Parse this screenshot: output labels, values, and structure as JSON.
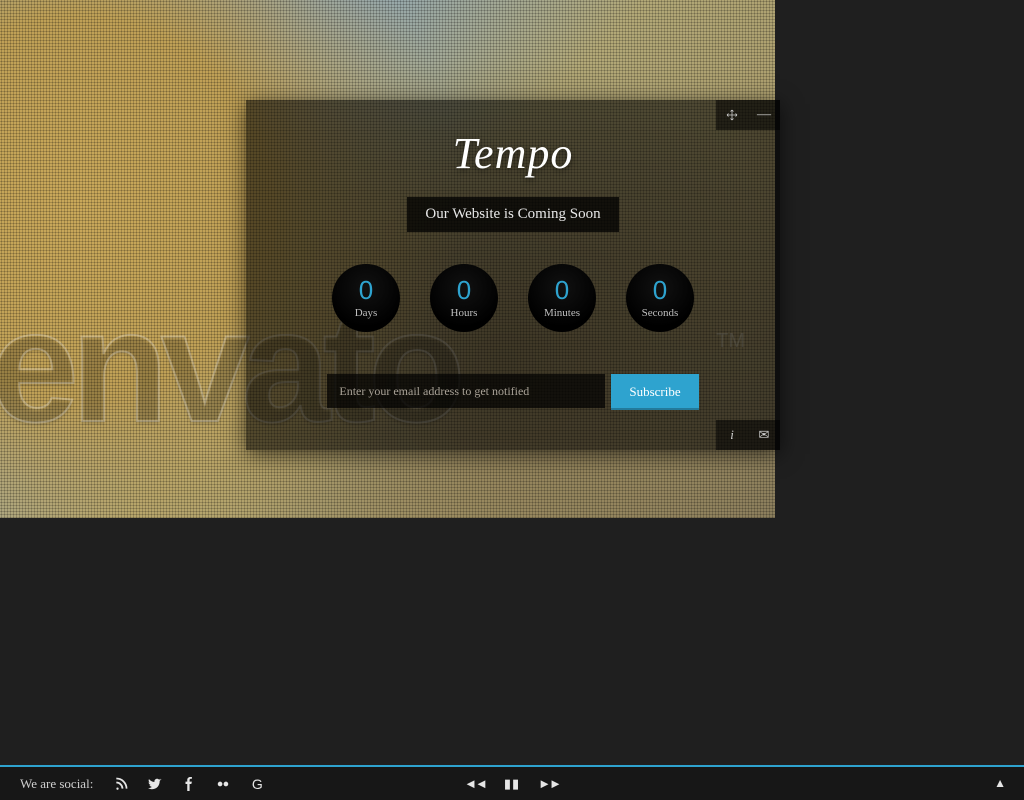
{
  "brand": "Tempo",
  "tagline": "Our Website is Coming Soon",
  "watermark": "envato",
  "watermark_tm": "TM",
  "countdown": {
    "days": {
      "value": "0",
      "label": "Days"
    },
    "hours": {
      "value": "0",
      "label": "Hours"
    },
    "minutes": {
      "value": "0",
      "label": "Minutes"
    },
    "seconds": {
      "value": "0",
      "label": "Seconds"
    }
  },
  "subscribe": {
    "placeholder": "Enter your email address to get notified",
    "button": "Subscribe"
  },
  "card_controls": {
    "info_glyph": "i",
    "mail_glyph": "✉",
    "minimize_glyph": "—"
  },
  "footer": {
    "social_label": "We are social:",
    "google_glyph": "G",
    "prev_glyph": "◄◄",
    "pause_glyph": "▮▮",
    "next_glyph": "►►",
    "top_glyph": "▲"
  },
  "colors": {
    "accent": "#2ea3cf",
    "bg_dark": "#1f1f1f",
    "footer_bg": "#171717"
  }
}
